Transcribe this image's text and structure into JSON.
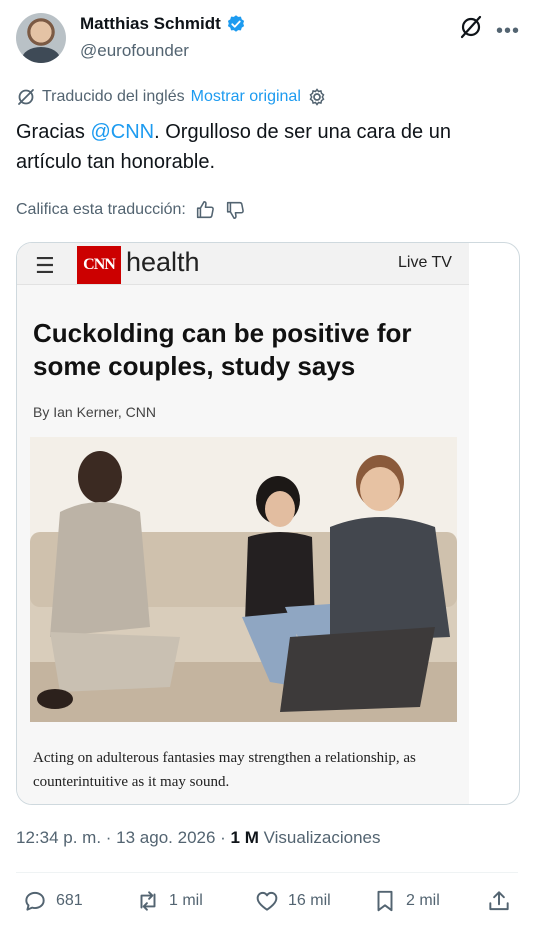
{
  "author": {
    "name": "Matthias Schmidt",
    "handle": "@eurofounder"
  },
  "translation": {
    "label": "Traducido del inglés",
    "show_original": "Mostrar original"
  },
  "tweet": {
    "text_before": "Gracias ",
    "mention": "@CNN",
    "text_after": ". Orgulloso de ser una cara de un artículo tan honorable."
  },
  "rate_translation": "Califica esta traducción:",
  "article": {
    "logo_text": "CNN",
    "section": "health",
    "live_tv": "Live TV",
    "headline": "Cuckolding can be positive for some couples, study says",
    "byline": "By Ian Kerner, CNN",
    "caption": "Acting on adulterous fantasies may strengthen a relationship, as counterintuitive as it may sound."
  },
  "meta": {
    "time": "12:34 p. m.",
    "separator": " · ",
    "date": "13 ago. 2026",
    "views_count": "1 M",
    "views_label": "Visualizaciones"
  },
  "actions": {
    "replies": "681",
    "reposts": "1 mil",
    "likes": "16 mil",
    "bookmarks": "2 mil"
  },
  "colors": {
    "accent": "#1d9bf0",
    "secondary_text": "#536471",
    "cnn_red": "#cc0000"
  },
  "icons": [
    "verified-icon",
    "grok-icon",
    "more-icon",
    "translate-icon",
    "settings-icon",
    "thumbs-up-icon",
    "thumbs-down-icon",
    "reply-icon",
    "repost-icon",
    "like-icon",
    "bookmark-icon",
    "share-icon"
  ]
}
